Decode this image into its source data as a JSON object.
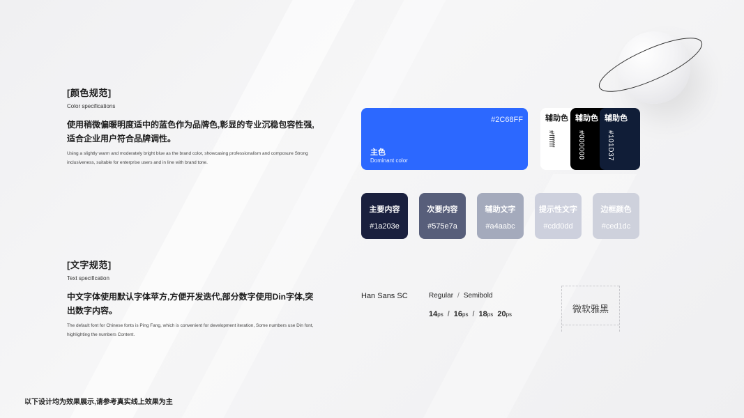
{
  "color_section": {
    "title": "[颜色规范]",
    "subtitle": "Color specifications",
    "description_zh": "使用稍微偏暖明度适中的蓝色作为品牌色,彰显的专业沉稳包容性强,适合企业用户符合品牌调性。",
    "description_en": "Using a slightly warm and moderately bright blue as the brand color, showcasing professionalism and composure Strong inclusiveness, suitable for enterprise users and in line with brand tone."
  },
  "primary_color": {
    "hex": "#2C68FF",
    "label_zh": "主色",
    "label_en": "Dominant color",
    "color": "#2C68FF"
  },
  "auxiliary_colors": [
    {
      "label": "辅助色",
      "hex": "#ffffff",
      "color": "#ffffff",
      "text_color": "#222222"
    },
    {
      "label": "辅助色",
      "hex": "#000000",
      "color": "#000000",
      "text_color": "#ffffff"
    },
    {
      "label": "辅助色",
      "hex": "#101D37",
      "color": "#101D37",
      "text_color": "#ffffff"
    }
  ],
  "text_colors": [
    {
      "label": "主要内容",
      "hex": "#1a203e",
      "color": "#1a203e"
    },
    {
      "label": "次要内容",
      "hex": "#575e7a",
      "color": "#575e7a"
    },
    {
      "label": "辅助文字",
      "hex": "#a4aabc",
      "color": "#a4aabc"
    },
    {
      "label": "提示性文字",
      "hex": "#cdd0dd",
      "color": "#cdd0dd"
    },
    {
      "label": "边框颜色",
      "hex": "#ced1dc",
      "color": "#ced1dc"
    }
  ],
  "text_section": {
    "title": "[文字规范]",
    "subtitle": "Text specification",
    "description_zh": "中文字体使用默认字体苹方,方便开发迭代,部分数字使用Din字体,突出数字内容。",
    "description_en": "The default font for Chinese fonts is Ping Fang, which is convenient for development iteration, Some numbers use Din font, highlighting the numbers Content."
  },
  "typography": {
    "font_name": "Han Sans SC",
    "weight_regular": "Regular",
    "weight_semibold": "Semibold",
    "separator": "/",
    "sizes": [
      {
        "num": "14",
        "unit": "ps"
      },
      {
        "num": "16",
        "unit": "ps"
      },
      {
        "num": "18",
        "unit": "ps"
      },
      {
        "num": "20",
        "unit": "ps"
      }
    ],
    "specimen": "微软雅黑"
  },
  "footer": "以下设计均为效果展示,请参考真实线上效果为主"
}
